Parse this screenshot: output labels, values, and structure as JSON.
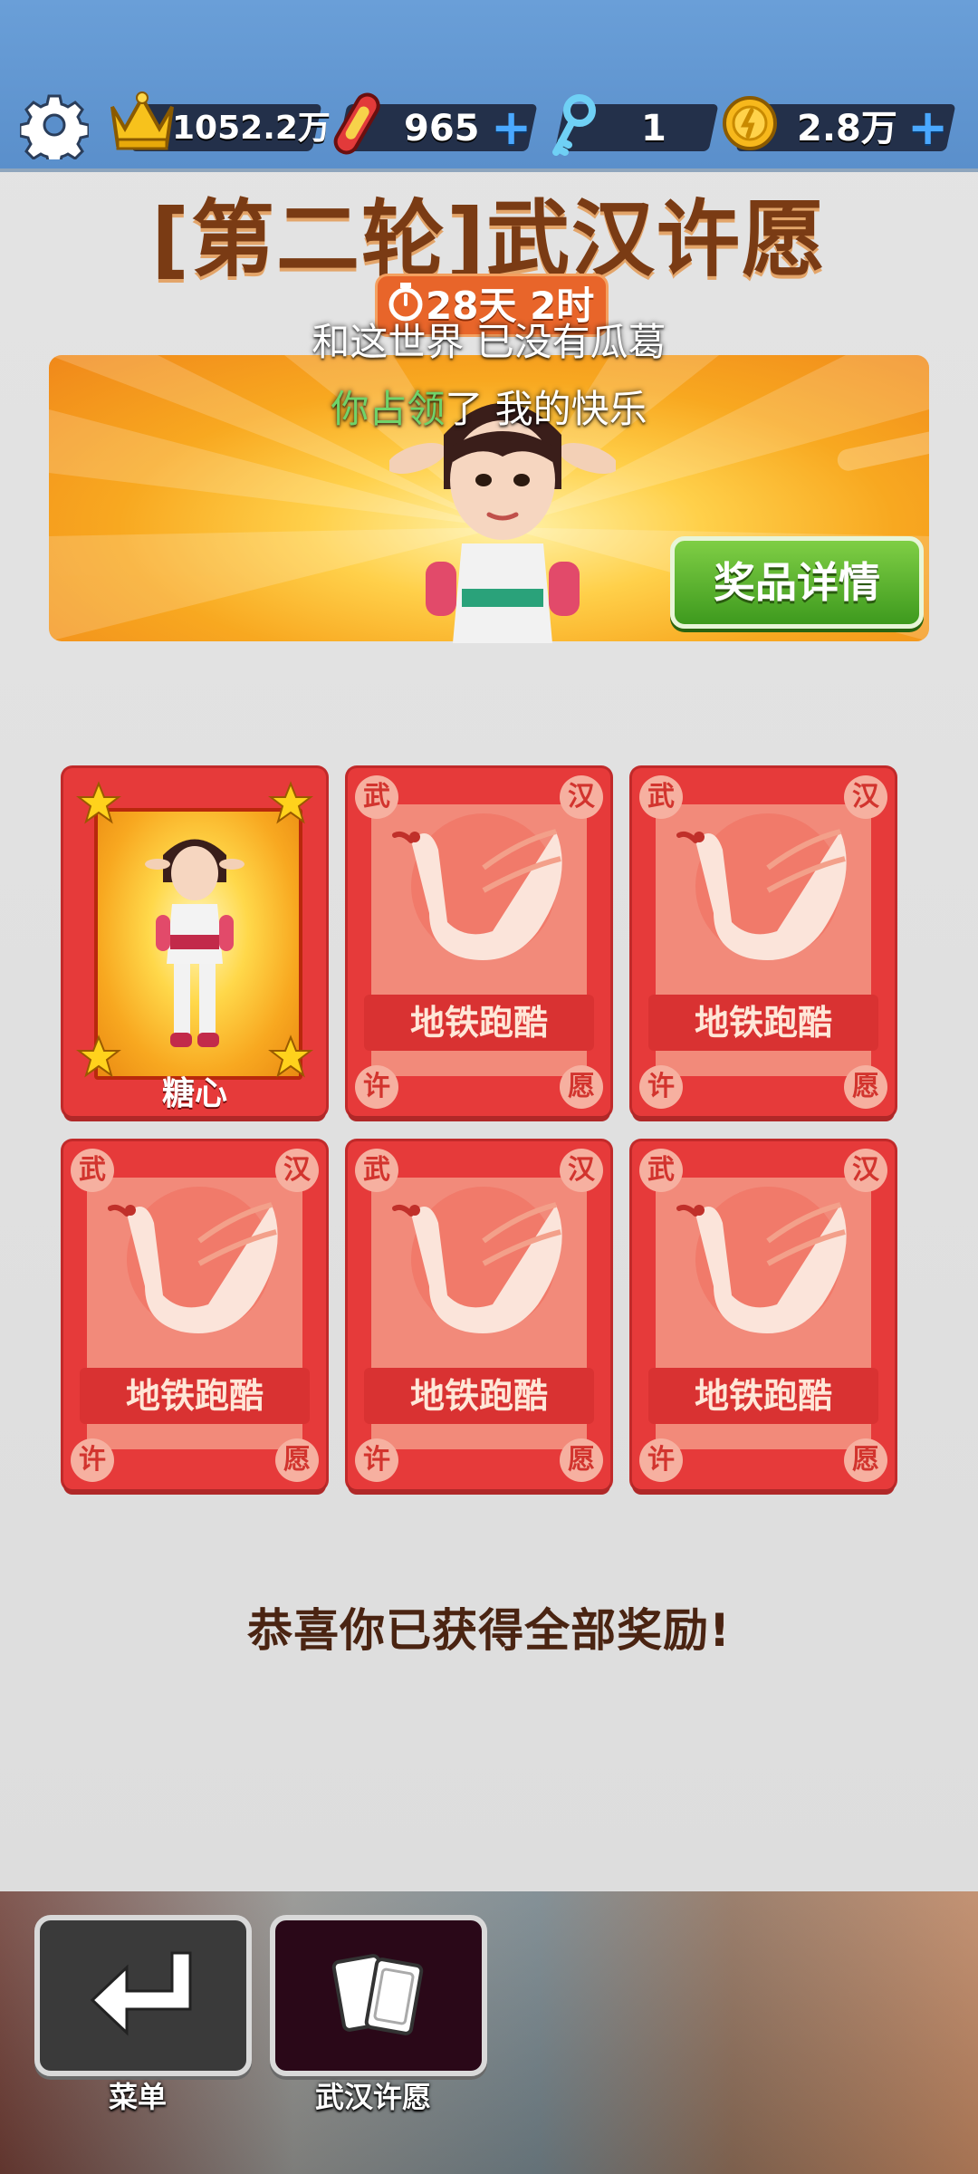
{
  "header": {
    "crowns": "1052.2万",
    "boards": "965",
    "keys": "1",
    "coins": "2.8万"
  },
  "title": "[第二轮]武汉许愿",
  "timer": "28天 2时",
  "lyrics": {
    "line1": "和这世界 已没有瓜葛",
    "line2_highlight": "你占领",
    "line2_rest": "了 我的快乐"
  },
  "banner": {
    "prize_button": "奖品详情"
  },
  "cards": {
    "unlocked_name": "糖心",
    "corner_chars": [
      "武",
      "汉",
      "许",
      "愿"
    ],
    "card_label": "地铁跑酷"
  },
  "congrats": "恭喜你已获得全部奖励!",
  "nav": {
    "menu_label": "菜单",
    "wish_label": "武汉许愿"
  },
  "colors": {
    "top_bar": "#5a8fcb",
    "title": "#7a3b14",
    "card_red": "#e63a3a",
    "prize_green": "#3e9a1e",
    "timer_orange": "#e8652a"
  },
  "icons": [
    "gear-icon",
    "crown-icon",
    "hoverboard-icon",
    "key-icon",
    "coin-icon",
    "plus-icon",
    "stopwatch-icon",
    "star-icon",
    "crane-icon",
    "return-icon",
    "cards-icon"
  ]
}
